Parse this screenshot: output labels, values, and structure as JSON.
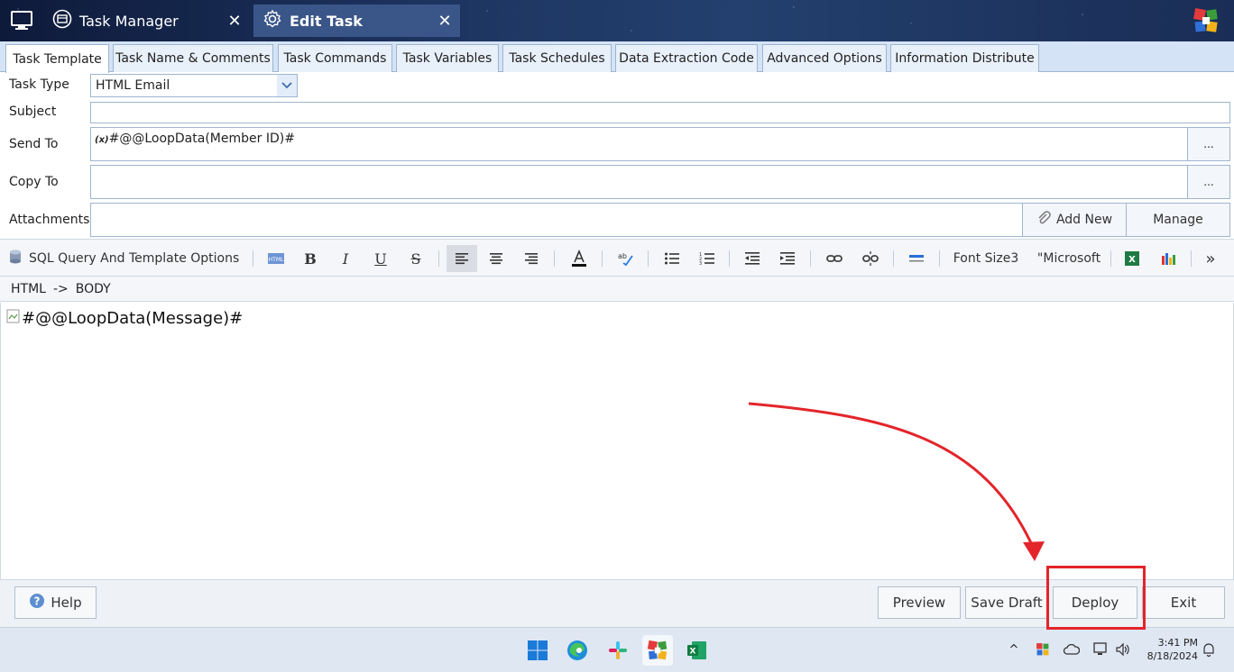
{
  "window": {
    "tabs": [
      {
        "label": "Task Manager",
        "icon": "task-manager-icon"
      },
      {
        "label": "Edit Task",
        "icon": "gear-icon"
      }
    ]
  },
  "tabs": [
    "Task Template",
    "Task Name & Comments",
    "Task Commands",
    "Task Variables",
    "Task Schedules",
    "Data Extraction Code",
    "Advanced Options",
    "Information Distribute"
  ],
  "form": {
    "task_type_label": "Task Type",
    "task_type_value": "HTML Email",
    "subject_label": "Subject",
    "subject_value": "",
    "send_to_label": "Send To",
    "send_to_var": "(x)",
    "send_to_value": "#@@LoopData(Member ID)#",
    "copy_to_label": "Copy To",
    "copy_to_value": "",
    "attachments_label": "Attachments",
    "dots": "...",
    "add_new": "Add New",
    "manage": "Manage"
  },
  "toolbar": {
    "sql_options": "SQL Query And Template Options",
    "bold": "B",
    "italic": "I",
    "underline": "U",
    "strike": "S",
    "font_size": "Font Size3",
    "font_name": "\"Microsoft",
    "more": "»"
  },
  "path": {
    "html": "HTML",
    "arrow": "->",
    "body": "BODY"
  },
  "editor": {
    "content": "#@@LoopData(Message)#"
  },
  "footer": {
    "help": "Help",
    "preview": "Preview",
    "save_draft": "Save Draft",
    "deploy": "Deploy",
    "exit": "Exit"
  },
  "taskbar": {
    "time": "3:41 PM",
    "date": "8/18/2024",
    "tray_up": "^"
  },
  "colors": {
    "accent": "#e3252b",
    "tab_bg": "#d4e3f5",
    "title_active": "#3a5688"
  }
}
